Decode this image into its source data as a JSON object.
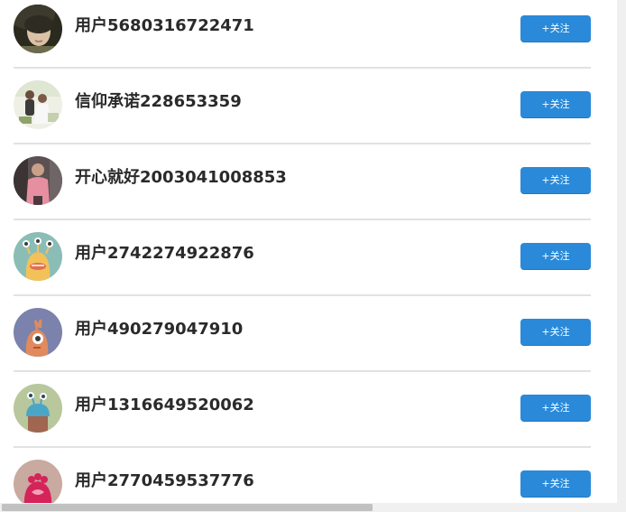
{
  "follow_label": "+关注",
  "users": [
    {
      "name": "用户5680316722471",
      "avatar": "photo-woman-avatar"
    },
    {
      "name": "信仰承诺228653359",
      "avatar": "photo-couple-avatar"
    },
    {
      "name": "开心就好2003041008853",
      "avatar": "photo-man-avatar"
    },
    {
      "name": "用户2742274922876",
      "avatar": "monster-yellow-avatar"
    },
    {
      "name": "用户490279047910",
      "avatar": "monster-orange-avatar"
    },
    {
      "name": "用户1316649520062",
      "avatar": "monster-green-avatar"
    },
    {
      "name": "用户2770459537776",
      "avatar": "monster-pink-avatar"
    }
  ],
  "colors": {
    "button": "#2a8ad9",
    "divider": "#e2e2e2",
    "text": "#2a2a2a"
  }
}
